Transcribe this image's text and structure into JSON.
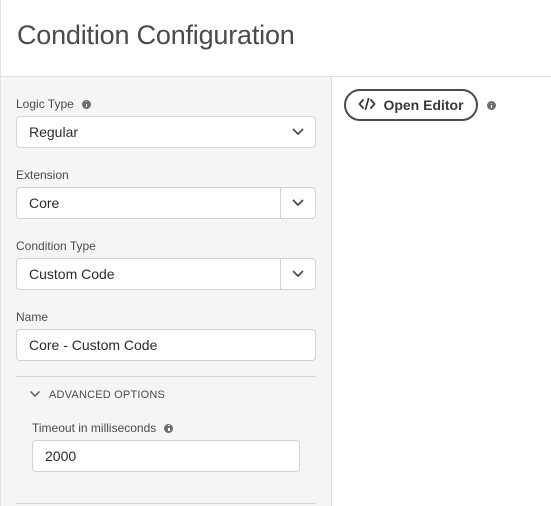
{
  "header": {
    "title": "Condition Configuration"
  },
  "form": {
    "logic_type": {
      "label": "Logic Type",
      "value": "Regular"
    },
    "extension": {
      "label": "Extension",
      "value": "Core"
    },
    "condition_type": {
      "label": "Condition Type",
      "value": "Custom Code"
    },
    "name": {
      "label": "Name",
      "value": "Core - Custom Code"
    },
    "advanced": {
      "toggle_label": "ADVANCED OPTIONS",
      "timeout_label": "Timeout in milliseconds",
      "timeout_value": "2000"
    }
  },
  "editor": {
    "open_label": "Open Editor"
  },
  "icons": {
    "info": "info-icon",
    "chevron": "chevron-down-icon",
    "code": "code-icon"
  }
}
